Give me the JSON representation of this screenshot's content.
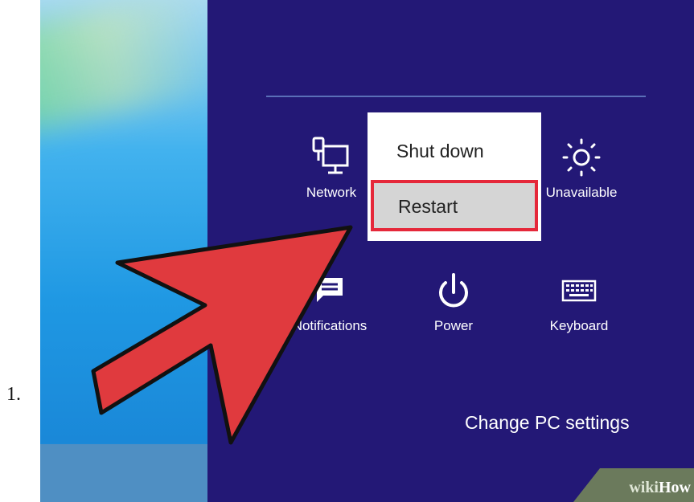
{
  "step_number": "1.",
  "charms": {
    "tiles": [
      {
        "label": "Network",
        "icon": "network-icon"
      },
      {
        "label": "Unavailable",
        "icon": "brightness-icon"
      },
      {
        "label": "Notifications",
        "icon": "notifications-icon"
      },
      {
        "label": "Power",
        "icon": "power-icon"
      },
      {
        "label": "Keyboard",
        "icon": "keyboard-icon"
      }
    ],
    "change_pc_settings": "Change PC settings"
  },
  "power_menu": {
    "items": [
      "Shut down",
      "Restart"
    ],
    "highlighted": "Restart"
  },
  "watermark": {
    "wiki": "wiki",
    "how": "How"
  },
  "colors": {
    "charms_bg": "#231876",
    "highlight_border": "#e5283a",
    "arrow": "#e03a3e"
  }
}
